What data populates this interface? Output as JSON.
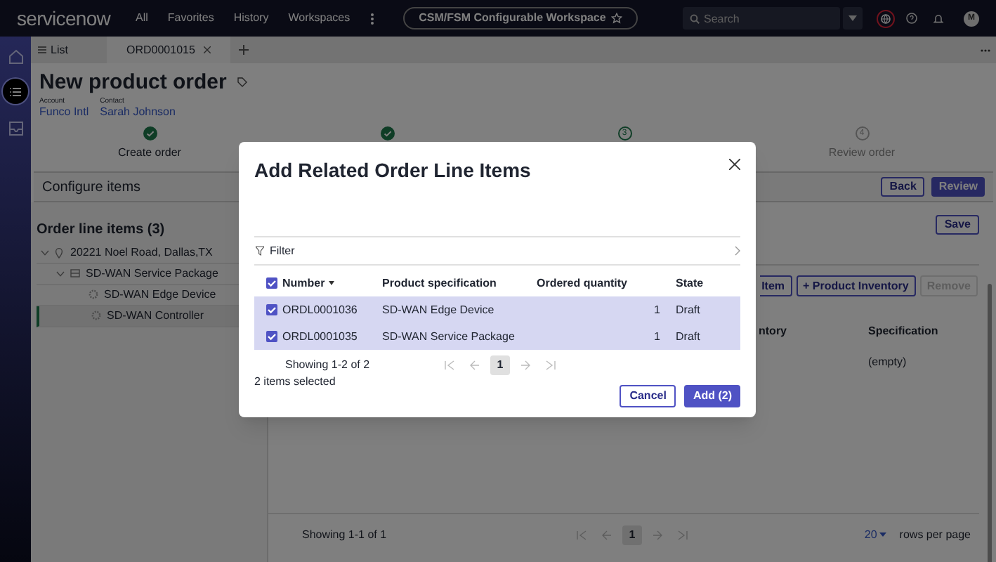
{
  "top_bar": {
    "logo": "servicenow",
    "nav": [
      "All",
      "Favorites",
      "History",
      "Workspaces"
    ],
    "workspace": "CSM/FSM Configurable Workspace",
    "search": {
      "placeholder": "Search"
    },
    "avatar": "M"
  },
  "rail": [
    {
      "kind": "home",
      "selected": false
    },
    {
      "kind": "list",
      "selected": true
    },
    {
      "kind": "inbox",
      "selected": false
    }
  ],
  "tabs": [
    {
      "label": "List",
      "kind": "list",
      "selected": false
    },
    {
      "label": "ORD0001015",
      "kind": "record",
      "selected": true
    }
  ],
  "record": {
    "title": "New product order",
    "fields": [
      {
        "label": "Account",
        "value": "Funco Intl"
      },
      {
        "label": "Contact",
        "value": "Sarah Johnson"
      }
    ]
  },
  "steps": [
    {
      "label": "Create order",
      "completed": true,
      "current": false
    },
    {
      "completed": true,
      "current": false
    },
    {
      "number": "3",
      "completed": false,
      "current": true
    },
    {
      "number": "4",
      "label": "Review order",
      "completed": false,
      "current": false
    }
  ],
  "configure_bar": {
    "title": "Configure items",
    "buttons": [
      {
        "label": "Back",
        "kind": "secondary"
      },
      {
        "label": "Review",
        "kind": "primary"
      }
    ]
  },
  "tree": {
    "title": "Order line items (3)",
    "items": [
      {
        "label": "20221 Noel Road, Dallas,TX",
        "kind": "location",
        "expanded": true,
        "selected": false,
        "children": [
          {
            "label": "SD-WAN Service Package",
            "kind": "package",
            "expanded": true,
            "selected": false,
            "children": [
              {
                "label": "SD-WAN Edge Device",
                "kind": "product",
                "selected": false
              },
              {
                "label": "SD-WAN Controller",
                "kind": "product",
                "selected": true
              }
            ]
          }
        ]
      }
    ]
  },
  "detail": {
    "save": "Save",
    "buttons": [
      {
        "label": "Item",
        "disabled": false
      },
      {
        "label": "+ Product Inventory",
        "disabled": false
      },
      {
        "label": "Remove",
        "disabled": true
      }
    ],
    "columns": [
      "ntory",
      "Specification"
    ],
    "rows": [
      [
        "",
        "(empty)"
      ]
    ],
    "footer": {
      "showing": "Showing 1-1 of 1",
      "page": "1",
      "rows_per_page": "20",
      "rows_label": "rows per page"
    }
  },
  "dialog": {
    "title": "Add Related Order Line Items",
    "filter": "Filter",
    "all_checked": true,
    "columns": [
      "Number",
      "Product specification",
      "Ordered quantity",
      "State"
    ],
    "rows": [
      {
        "number": "ORDL0001036",
        "spec": "SD-WAN Edge Device",
        "qty": "1",
        "state": "Draft",
        "selected": true
      },
      {
        "number": "ORDL0001035",
        "spec": "SD-WAN Service Package",
        "qty": "1",
        "state": "Draft",
        "selected": true
      }
    ],
    "showing": "Showing 1-2 of 2",
    "page": "1",
    "selected_count": "2 items selected",
    "buttons": [
      {
        "label": "Cancel",
        "kind": "secondary"
      },
      {
        "label": "Add (2)",
        "kind": "primary"
      }
    ]
  }
}
